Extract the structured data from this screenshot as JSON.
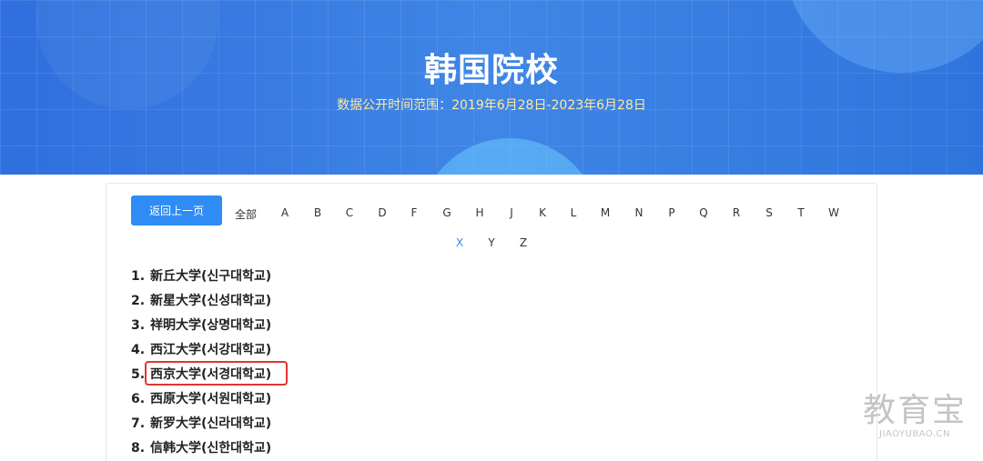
{
  "header": {
    "title": "韩国院校",
    "subtitle": "数据公开时间范围：2019年6月28日-2023年6月28日"
  },
  "toolbar": {
    "back_label": "返回上一页"
  },
  "filters": {
    "all_label": "全部",
    "letters": [
      "A",
      "B",
      "C",
      "D",
      "F",
      "G",
      "H",
      "J",
      "K",
      "L",
      "M",
      "N",
      "P",
      "Q",
      "R",
      "S",
      "T",
      "W",
      "X",
      "Y",
      "Z"
    ],
    "active": "X"
  },
  "universities": [
    {
      "num": "1.",
      "name": "新丘大学(신구대학교)"
    },
    {
      "num": "2.",
      "name": "新星大学(신성대학교)"
    },
    {
      "num": "3.",
      "name": "祥明大学(상명대학교)"
    },
    {
      "num": "4.",
      "name": "西江大学(서강대학교)"
    },
    {
      "num": "5.",
      "name": "西京大学(서경대학교)"
    },
    {
      "num": "6.",
      "name": "西原大学(서원대학교)"
    },
    {
      "num": "7.",
      "name": "新罗大学(신라대학교)"
    },
    {
      "num": "8.",
      "name": "信韩大学(신한대학교)"
    }
  ],
  "watermark": {
    "main": "教育宝",
    "sub": "JIAOYUBAO.CN"
  },
  "colors": {
    "banner_blue": "#3f86e6",
    "accent": "#2f8cf5",
    "highlight_border": "#e0372e",
    "subtitle": "#ffe9a6"
  }
}
